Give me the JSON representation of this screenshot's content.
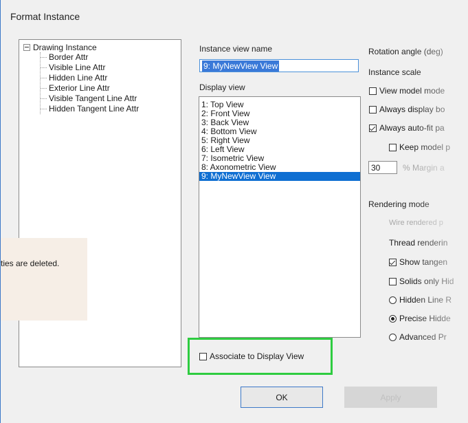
{
  "dialog": {
    "title": "Format Instance"
  },
  "tree": {
    "root": "Drawing Instance",
    "children": [
      "Border Attr",
      "Visible Line Attr",
      "Hidden Line Attr",
      "Exterior Line Attr",
      "Visible Tangent Line Attr",
      "Hidden Tangent Line Attr"
    ]
  },
  "instance_view_name": {
    "label": "Instance view name",
    "value": "9: MyNewView View"
  },
  "display_view": {
    "label": "Display view",
    "items": [
      "1: Top View",
      "2: Front View",
      "3: Back View",
      "4: Bottom View",
      "5: Right View",
      "6: Left View",
      "7: Isometric View",
      "8: Axonometric View",
      "9: MyNewView View"
    ],
    "selected_index": 8
  },
  "associate": {
    "label": "Associate to Display View",
    "checked": false
  },
  "right_panel": {
    "rotation_label": "Rotation angle (deg)",
    "instance_scale_label": "Instance scale",
    "view_model_mode": "View model mode",
    "always_display": "Always display bo",
    "always_autofit": "Always auto-fit pa",
    "keep_model": "Keep model p",
    "margin_value": "30",
    "margin_label": "% Margin a",
    "rendering_mode_label": "Rendering mode",
    "wire_rendered": "Wire rendered p",
    "thread_rendering": "Thread renderin",
    "show_tangent": "Show tangen",
    "solids_only": "Solids only Hid",
    "hidden_line": "Hidden Line R",
    "precise_hidden": "Precise Hidde",
    "advanced": "Advanced Pr"
  },
  "toast": {
    "text": "ties are deleted."
  },
  "buttons": {
    "ok": "OK",
    "apply": "Apply"
  },
  "colors": {
    "selection": "#0f6fd2",
    "highlight": "#2ecc40",
    "accent": "#3c78c8"
  }
}
